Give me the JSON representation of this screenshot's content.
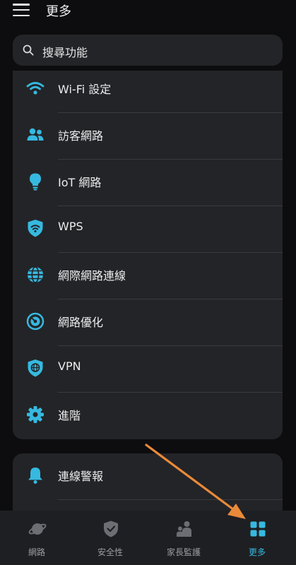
{
  "header": {
    "title": "更多"
  },
  "search": {
    "placeholder": "搜尋功能"
  },
  "menu": [
    {
      "label": "Wi-Fi 設定",
      "icon": "wifi-icon"
    },
    {
      "label": "訪客網路",
      "icon": "guest-users-icon"
    },
    {
      "label": "IoT 網路",
      "icon": "lightbulb-icon"
    },
    {
      "label": "WPS",
      "icon": "wps-shield-icon"
    },
    {
      "label": "網際網路連線",
      "icon": "globe-icon"
    },
    {
      "label": "網路優化",
      "icon": "optimization-gauge-icon"
    },
    {
      "label": "VPN",
      "icon": "vpn-shield-icon"
    },
    {
      "label": "進階",
      "icon": "gear-icon"
    }
  ],
  "menu2": [
    {
      "label": "連線警報",
      "icon": "bell-icon"
    }
  ],
  "bottom_nav": [
    {
      "label": "網路",
      "icon": "planet-icon",
      "active": false
    },
    {
      "label": "安全性",
      "icon": "shield-check-icon",
      "active": false
    },
    {
      "label": "家長監護",
      "icon": "family-icon",
      "active": false
    },
    {
      "label": "更多",
      "icon": "grid-icon",
      "active": true
    }
  ],
  "colors": {
    "accent": "#36b9e0",
    "background": "#0d0d0f",
    "card": "#232427",
    "arrow": "#e98a3a"
  }
}
